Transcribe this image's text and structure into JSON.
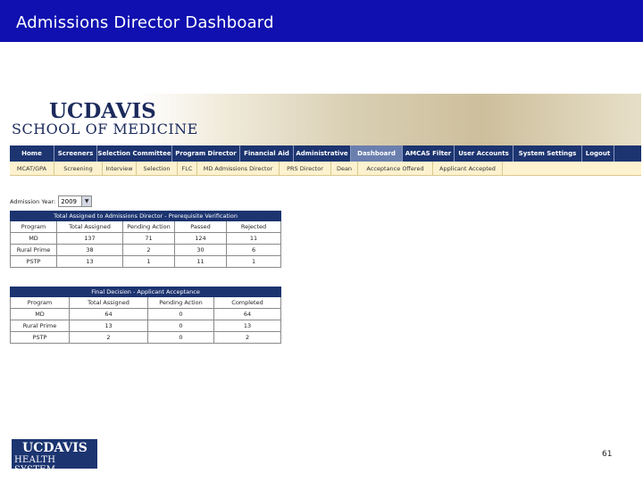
{
  "slide": {
    "title": "Admissions Director Dashboard",
    "page_number": "61"
  },
  "colors": {
    "title_bar": "#1010b0",
    "nav_bar": "#1c3470",
    "nav_active": "#6a7fae",
    "subnav_bar": "#fdf2cf"
  },
  "banner": {
    "logo_uc": "UCDAVIS",
    "logo_school": "SCHOOL OF MEDICINE"
  },
  "nav": {
    "items": [
      {
        "label": "Home"
      },
      {
        "label": "Screeners"
      },
      {
        "label": "Selection Committee"
      },
      {
        "label": "Program Director"
      },
      {
        "label": "Financial Aid"
      },
      {
        "label": "Administrative"
      },
      {
        "label": "Dashboard",
        "active": true
      },
      {
        "label": "AMCAS Filter"
      },
      {
        "label": "User Accounts"
      },
      {
        "label": "System Settings"
      },
      {
        "label": "Logout"
      }
    ]
  },
  "subnav": {
    "items": [
      {
        "label": "MCAT/GPA"
      },
      {
        "label": "Screening"
      },
      {
        "label": "Interview"
      },
      {
        "label": "Selection"
      },
      {
        "label": "FLC"
      },
      {
        "label": "MD Admissions Director"
      },
      {
        "label": "PRS Director"
      },
      {
        "label": "Dean"
      },
      {
        "label": "Acceptance Offered"
      },
      {
        "label": "Applicant Accepted"
      }
    ]
  },
  "filters": {
    "admission_year_label": "Admission Year:",
    "admission_year_value": "2009",
    "dropdown_arrow": "▼"
  },
  "table1": {
    "caption": "Total Assigned to Admissions Director - Prerequisite Verification",
    "headers": [
      "Program",
      "Total Assigned",
      "Pending Action",
      "Passed",
      "Rejected"
    ],
    "rows": [
      [
        "MD",
        "137",
        "71",
        "124",
        "11"
      ],
      [
        "Rural Prime",
        "38",
        "2",
        "30",
        "6"
      ],
      [
        "PSTP",
        "13",
        "1",
        "11",
        "1"
      ]
    ]
  },
  "table2": {
    "caption": "Final Decision - Applicant Acceptance",
    "headers": [
      "Program",
      "Total Assigned",
      "Pending Action",
      "Completed"
    ],
    "rows": [
      [
        "MD",
        "64",
        "0",
        "64"
      ],
      [
        "Rural Prime",
        "13",
        "0",
        "13"
      ],
      [
        "PSTP",
        "2",
        "0",
        "2"
      ]
    ]
  },
  "footer": {
    "logo_uc": "UCDAVIS",
    "logo_health": "HEALTH SYSTEM"
  }
}
